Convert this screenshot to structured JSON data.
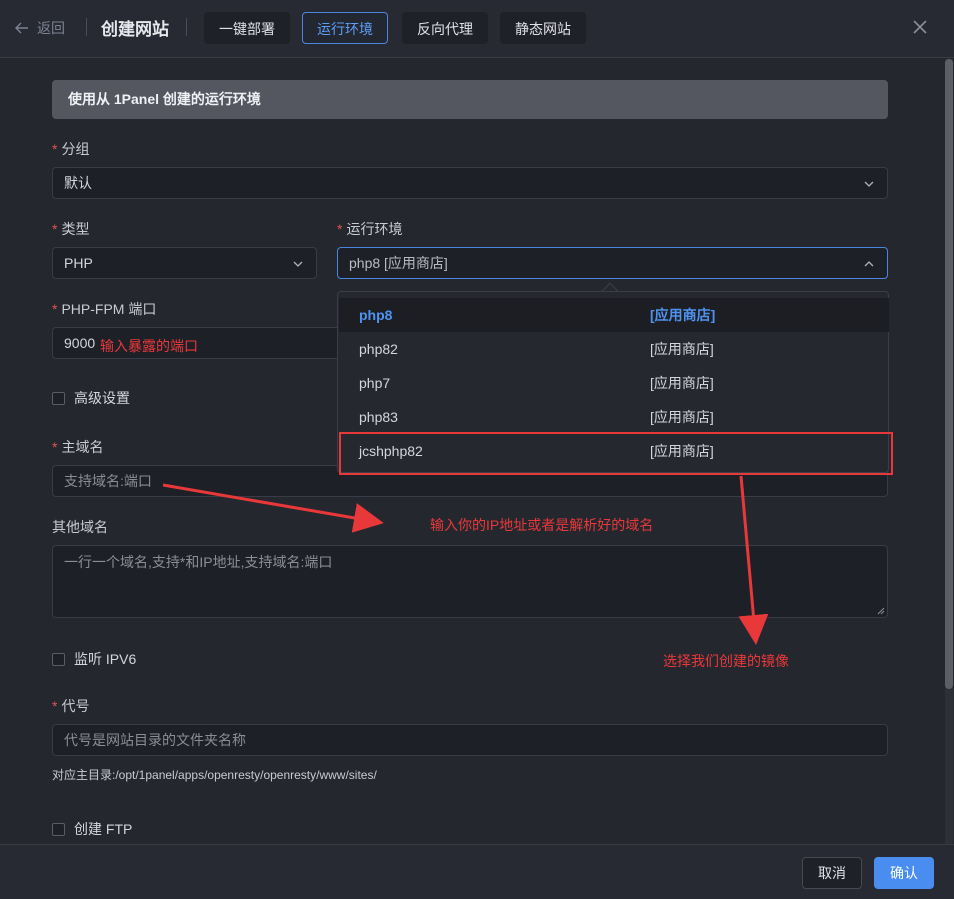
{
  "header": {
    "back_label": "返回",
    "title": "创建网站",
    "tabs": [
      {
        "label": "一键部署"
      },
      {
        "label": "运行环境",
        "active": true
      },
      {
        "label": "反向代理"
      },
      {
        "label": "静态网站"
      }
    ]
  },
  "form": {
    "banner": "使用从 1Panel 创建的运行环境",
    "group": {
      "label": "分组",
      "value": "默认"
    },
    "type": {
      "label": "类型",
      "value": "PHP"
    },
    "runtime": {
      "label": "运行环境",
      "value": "php8 [应用商店]"
    },
    "port": {
      "label": "PHP-FPM 端口",
      "value": "9000"
    },
    "advanced": {
      "label": "高级设置"
    },
    "primary_domain": {
      "label": "主域名",
      "placeholder": "支持域名:端口"
    },
    "other_domains": {
      "label": "其他域名",
      "placeholder": "一行一个域名,支持*和IP地址,支持域名:端口"
    },
    "ipv6": {
      "label": "监听 IPV6"
    },
    "alias": {
      "label": "代号",
      "placeholder": "代号是网站目录的文件夹名称",
      "hint": "对应主目录:/opt/1panel/apps/openresty/openresty/www/sites/"
    },
    "ftp": {
      "label": "创建 FTP"
    }
  },
  "runtime_options": [
    {
      "name": "php8",
      "tag": "[应用商店]",
      "selected": true
    },
    {
      "name": "php82",
      "tag": "[应用商店]"
    },
    {
      "name": "php7",
      "tag": "[应用商店]"
    },
    {
      "name": "php83",
      "tag": "[应用商店]"
    },
    {
      "name": "jcshphp82",
      "tag": "[应用商店]"
    }
  ],
  "annotations": {
    "port_note": "输入暴露的端口",
    "domain_note": "输入你的IP地址或者是解析好的域名",
    "runtime_note": "选择我们创建的镜像"
  },
  "footer": {
    "cancel_label": "取消",
    "confirm_label": "确认"
  },
  "colors": {
    "accent": "#4a8df0",
    "annotation": "#e8383a",
    "background": "#25272f"
  }
}
